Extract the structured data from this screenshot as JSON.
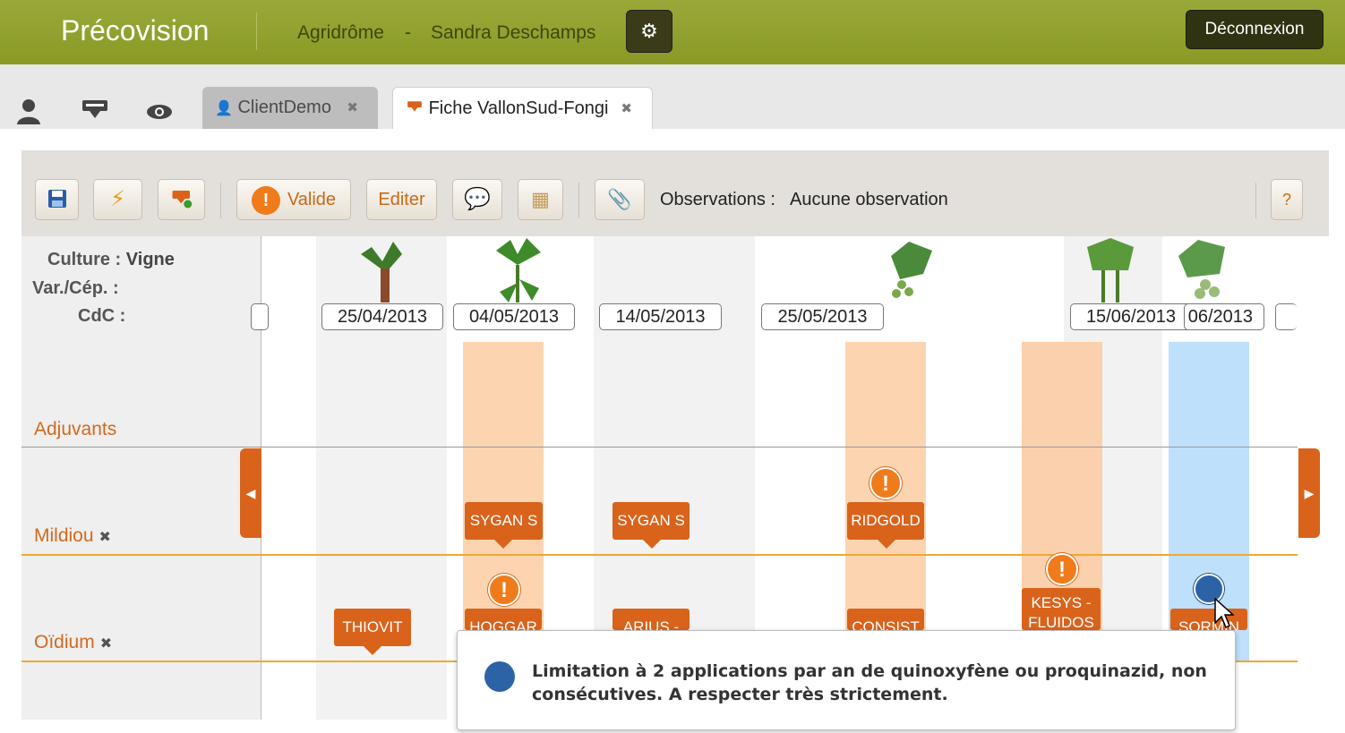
{
  "header": {
    "brand": "Précovision",
    "org": "Agridrôme",
    "separator": "-",
    "user": "Sandra Deschamps",
    "logout_label": "Déconnexion"
  },
  "tabs": {
    "client_tab": "ClientDemo",
    "fiche_tab": "Fiche VallonSud-Fongi",
    "close_glyph": "✖"
  },
  "toolbar": {
    "valide_label": "Valide",
    "editer_label": "Editer",
    "observations_label": "Observations :",
    "observations_value": "Aucune observation",
    "help_label": "?"
  },
  "left": {
    "culture_label": "Culture :",
    "culture_value": "Vigne",
    "var_label": "Var./Cép. :",
    "cdc_label": "CdC :",
    "rows": [
      {
        "label": "Adjuvants"
      },
      {
        "label": "Mildiou",
        "close": "✖"
      },
      {
        "label": "Oïdium",
        "close": "✖"
      }
    ]
  },
  "timeline": {
    "dates": [
      "25/04/2013",
      "04/05/2013",
      "14/05/2013",
      "25/05/2013",
      "15/06/2013",
      "06/2013"
    ],
    "mildiou_tags": [
      "SYGAN S",
      "SYGAN S",
      "RIDGOLD"
    ],
    "oidium_tags": [
      "THIOVIT",
      "HOGGAR",
      "ARIUS -",
      "CONSIST",
      "KESYS - FLUIDOS",
      "SORMIN"
    ]
  },
  "tooltip": {
    "text": "Limitation à 2 applications par an de quinoxyfène ou proquinazid, non consécutives. A respecter très strictement."
  },
  "colors": {
    "header_green": "#8a9a24",
    "accent_orange": "#d9631b",
    "band_orange": "#fcd5b0",
    "band_blue": "#bfe0fa"
  }
}
